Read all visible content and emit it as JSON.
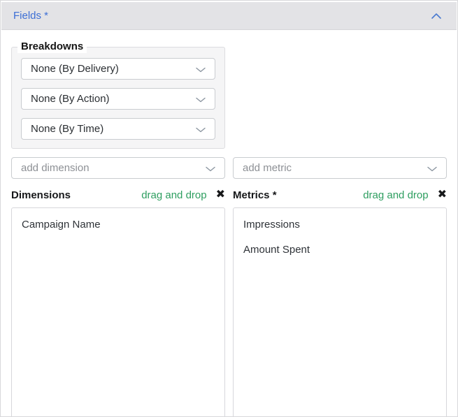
{
  "panel": {
    "title": "Fields *"
  },
  "breakdowns": {
    "legend": "Breakdowns",
    "options": [
      "None (By Delivery)",
      "None (By Action)",
      "None (By Time)"
    ]
  },
  "add_row": {
    "dimension_placeholder": "add dimension",
    "metric_placeholder": "add metric"
  },
  "dimensions": {
    "title": "Dimensions",
    "hint": "drag and drop",
    "items": [
      "Campaign Name"
    ]
  },
  "metrics": {
    "title": "Metrics *",
    "hint": "drag and drop",
    "items": [
      "Impressions",
      "Amount Spent"
    ]
  },
  "icons": {
    "collapse": "chevron-up",
    "select_arrow": "chevron-down",
    "remove_glyph": "✖"
  },
  "colors": {
    "accent_blue": "#3d6fd5",
    "hint_green": "#2e9e60",
    "header_bg": "#e3e3e6"
  }
}
